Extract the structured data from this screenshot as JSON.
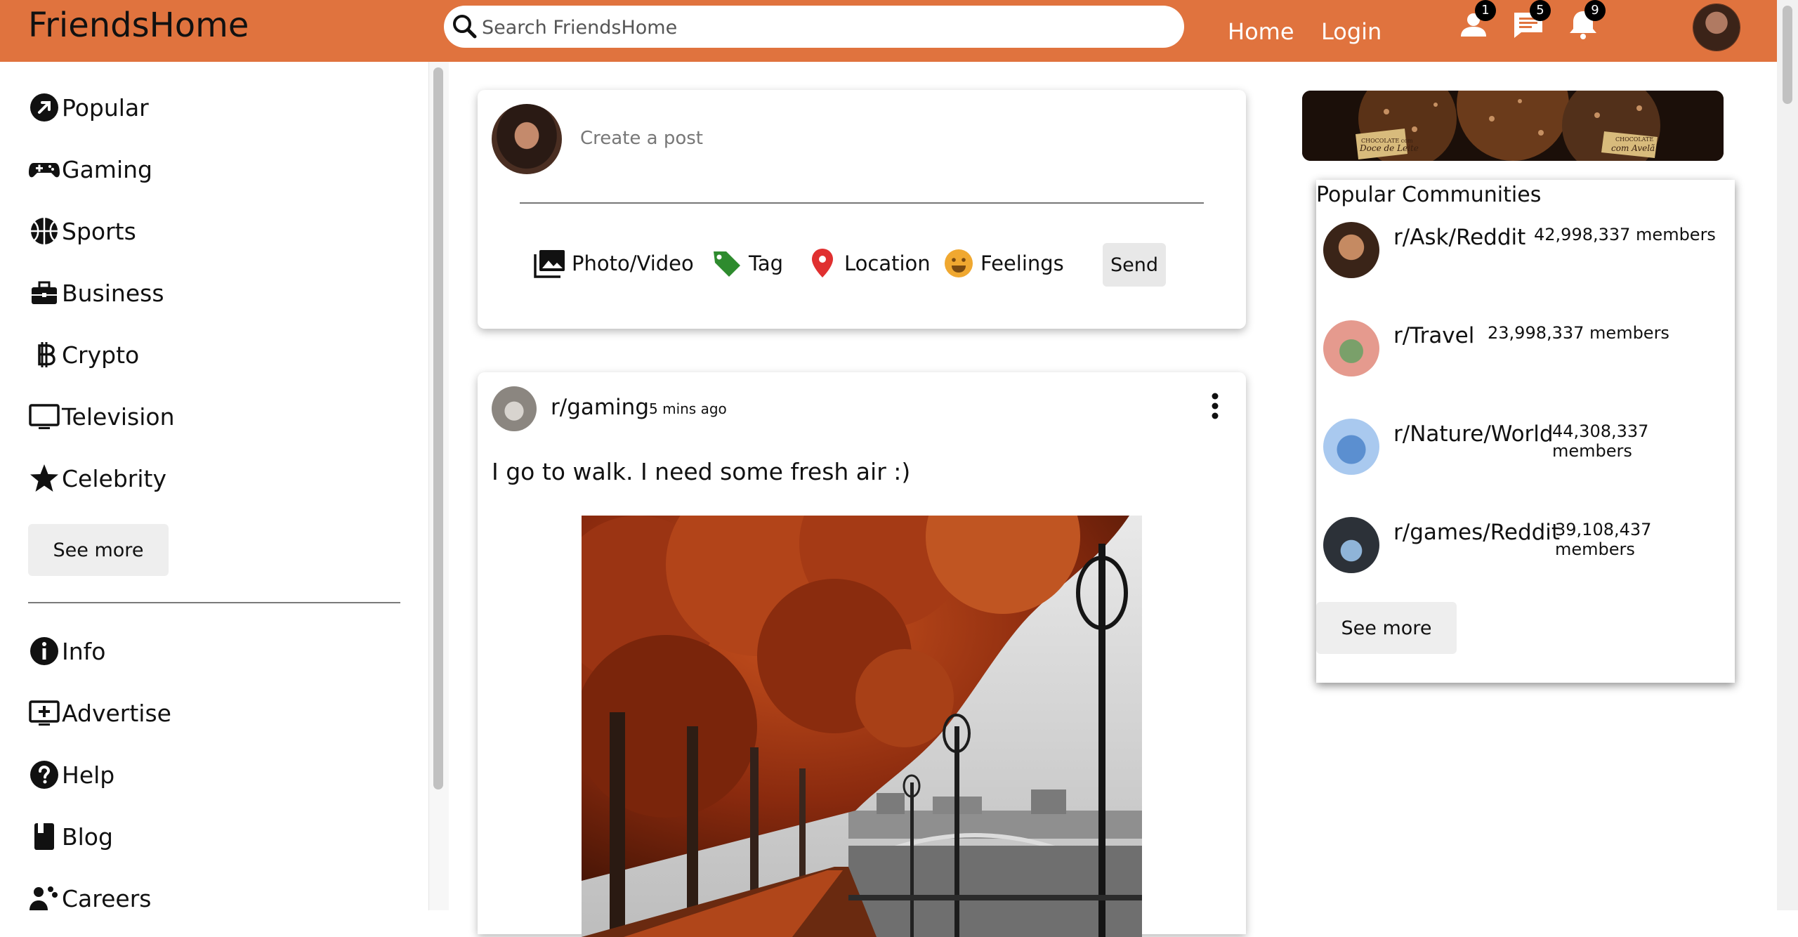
{
  "header": {
    "logo": "FriendsHome",
    "search_placeholder": "Search FriendsHome",
    "nav": {
      "home": "Home",
      "login": "Login"
    },
    "badges": {
      "friends": "1",
      "messages": "5",
      "notifications": "9"
    }
  },
  "sidebar": {
    "items": [
      {
        "label": "Popular",
        "icon": "trending-arrow-icon"
      },
      {
        "label": "Gaming",
        "icon": "gamepad-icon"
      },
      {
        "label": "Sports",
        "icon": "basketball-icon"
      },
      {
        "label": "Business",
        "icon": "briefcase-icon"
      },
      {
        "label": "Crypto",
        "icon": "bitcoin-icon"
      },
      {
        "label": "Television",
        "icon": "tv-icon"
      },
      {
        "label": "Celebrity",
        "icon": "star-icon"
      }
    ],
    "see_more": "See more",
    "links": [
      {
        "label": "Info",
        "icon": "info-icon"
      },
      {
        "label": "Advertise",
        "icon": "add-box-icon"
      },
      {
        "label": "Help",
        "icon": "help-icon"
      },
      {
        "label": "Blog",
        "icon": "book-icon"
      },
      {
        "label": "Careers",
        "icon": "people-icon"
      }
    ]
  },
  "create_post": {
    "placeholder": "Create a post",
    "options": {
      "photo": "Photo/Video",
      "tag": "Tag",
      "location": "Location",
      "feelings": "Feelings"
    },
    "send": "Send"
  },
  "post": {
    "community": "r/gaming",
    "time": "5 mins ago",
    "text": "I go to walk. I need some fresh air :)"
  },
  "ad": {
    "label_left_top": "CHOCOLATE com",
    "label_left": "Doce de Leite",
    "label_right_top": "CHOCOLATE",
    "label_right": "com Avelã"
  },
  "communities": {
    "title": "Popular Communities",
    "items": [
      {
        "name": "r/Ask/Reddit",
        "members": "42,998,337 members"
      },
      {
        "name": "r/Travel",
        "members": "23,998,337 members"
      },
      {
        "name": "r/Nature/World",
        "members": "44,308,337 members"
      },
      {
        "name": "r/games/Reddit",
        "members": "39,108,437 members"
      }
    ],
    "see_more": "See more"
  },
  "colors": {
    "brand": "#e0733e",
    "tag_green": "#2e8b2e",
    "location_red": "#e03030",
    "feelings_yellow": "#f0a830"
  }
}
